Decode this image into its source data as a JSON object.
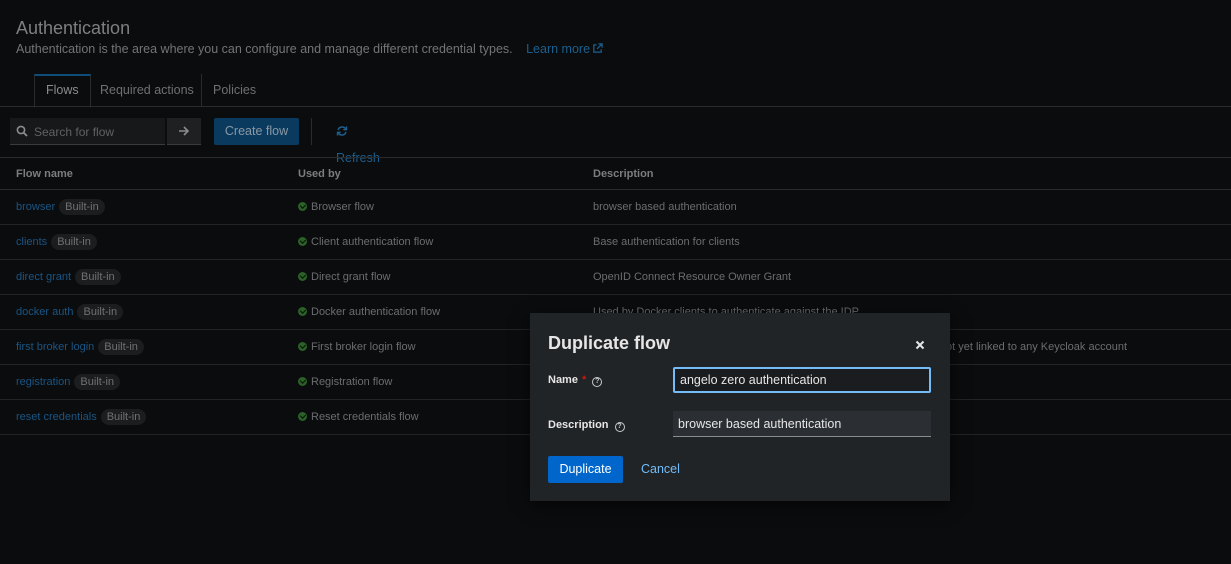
{
  "header": {
    "title": "Authentication",
    "subtitle": "Authentication is the area where you can configure and manage different credential types.",
    "learn_more": "Learn more"
  },
  "tabs": [
    {
      "label": "Flows",
      "active": true
    },
    {
      "label": "Required actions",
      "active": false
    },
    {
      "label": "Policies",
      "active": false
    }
  ],
  "toolbar": {
    "search_placeholder": "Search for flow",
    "create_label": "Create flow",
    "refresh_label": "Refresh"
  },
  "table": {
    "columns": [
      "Flow name",
      "Used by",
      "Description"
    ],
    "rows": [
      {
        "name": "browser",
        "badge": "Built-in",
        "used_by": "Browser flow",
        "description": "browser based authentication"
      },
      {
        "name": "clients",
        "badge": "Built-in",
        "used_by": "Client authentication flow",
        "description": "Base authentication for clients"
      },
      {
        "name": "direct grant",
        "badge": "Built-in",
        "used_by": "Direct grant flow",
        "description": "OpenID Connect Resource Owner Grant"
      },
      {
        "name": "docker auth",
        "badge": "Built-in",
        "used_by": "Docker authentication flow",
        "description": "Used by Docker clients to authenticate against the IDP"
      },
      {
        "name": "first broker login",
        "badge": "Built-in",
        "used_by": "First broker login flow",
        "description": "ot yet linked to any Keycloak account"
      },
      {
        "name": "registration",
        "badge": "Built-in",
        "used_by": "Registration flow",
        "description": ""
      },
      {
        "name": "reset credentials",
        "badge": "Built-in",
        "used_by": "Reset credentials flow",
        "description": ""
      }
    ]
  },
  "modal": {
    "title": "Duplicate flow",
    "name_label": "Name",
    "name_required": "*",
    "name_value": "angelo zero authentication",
    "description_label": "Description",
    "description_value": "browser based authentication",
    "duplicate_label": "Duplicate",
    "cancel_label": "Cancel"
  },
  "colors": {
    "backdrop": "#0b0c0d",
    "modal_bg": "#212427",
    "primary": "#0066cc",
    "link": "#73bcf7",
    "success": "#3e8635"
  }
}
